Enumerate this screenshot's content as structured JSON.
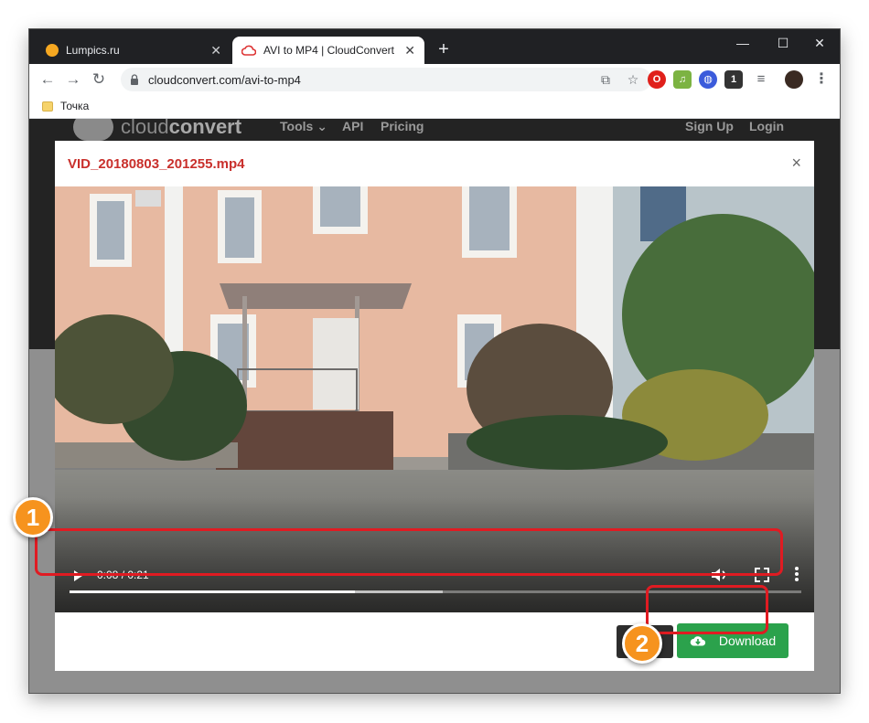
{
  "browser": {
    "tabs": [
      {
        "label": "Lumpics.ru",
        "active": false
      },
      {
        "label": "AVI to MP4 | CloudConvert",
        "active": true
      }
    ],
    "new_tab_symbol": "+",
    "window_controls": {
      "minimize": "—",
      "maximize": "☐",
      "close": "✕"
    },
    "url": "cloudconvert.com/avi-to-mp4",
    "bookmarks": [
      {
        "label": "Точка"
      }
    ],
    "extensions": [
      {
        "name": "opera-icon",
        "color": "#e0201b",
        "glyph": "O"
      },
      {
        "name": "music-icon",
        "color": "#7cb342",
        "glyph": "♫"
      },
      {
        "name": "globe-icon",
        "color": "#3b5bdb",
        "glyph": "◍"
      },
      {
        "name": "puzzle-icon",
        "color": "#333333",
        "glyph": "1"
      },
      {
        "name": "playlist-icon",
        "color": "#5f6368",
        "glyph": "≡"
      }
    ]
  },
  "site": {
    "logo": {
      "prefix": "cloud",
      "suffix": "convert"
    },
    "nav": [
      "Tools",
      "API",
      "Pricing"
    ],
    "nav_right": [
      "Sign Up",
      "Login"
    ],
    "tools_caret": "⌄"
  },
  "modal": {
    "title": "VID_20180803_201255.mp4",
    "close_symbol": "×",
    "video": {
      "time": "0:08 / 0:21",
      "progress": 0.39,
      "buffered": 0.51
    },
    "buttons": {
      "close": "Close",
      "download": "Download"
    }
  },
  "annotations": {
    "marker1": "1",
    "marker2": "2",
    "highlight_color": "#e01b22",
    "marker_color": "#f6931e"
  },
  "colors": {
    "download_green": "#2ba24c",
    "title_red": "#c9302c",
    "chrome_dark": "#202124"
  }
}
